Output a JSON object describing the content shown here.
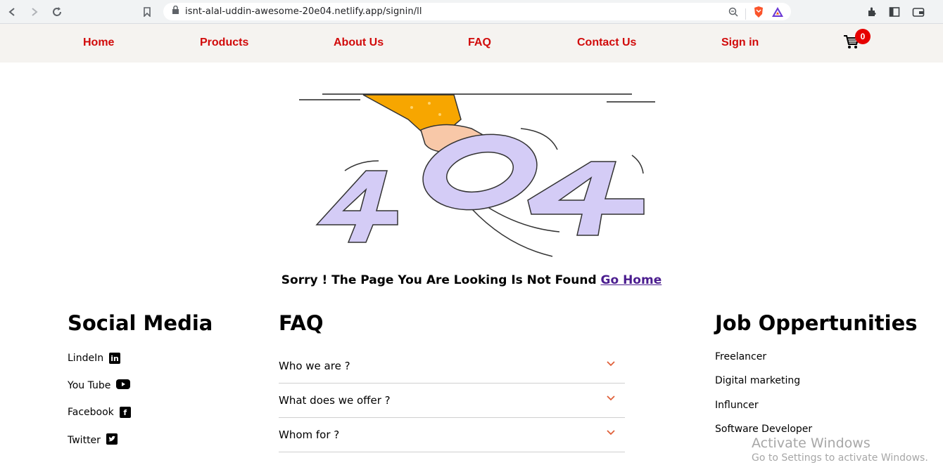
{
  "browser": {
    "url": "isnt-alal-uddin-awesome-20e04.netlify.app/signin/ll"
  },
  "nav": {
    "links": [
      "Home",
      "Products",
      "About Us",
      "FAQ",
      "Contact Us",
      "Sign in"
    ],
    "cart_count": "0",
    "link_color": "#d10a0a"
  },
  "error": {
    "image_text": "404",
    "message": "Sorry ! The Page You Are Looking Is Not Found",
    "go_home": "Go Home"
  },
  "footer": {
    "social": {
      "title": "Social Media",
      "items": [
        {
          "label": "LindeIn",
          "icon": "linkedin-icon"
        },
        {
          "label": "You Tube",
          "icon": "youtube-icon"
        },
        {
          "label": "Facebook",
          "icon": "facebook-icon"
        },
        {
          "label": "Twitter",
          "icon": "twitter-icon"
        }
      ]
    },
    "faq": {
      "title": "FAQ",
      "items": [
        "Who we are ?",
        "What does we offer ?",
        "Whom for ?"
      ]
    },
    "jobs": {
      "title": "Job Oppertunities",
      "items": [
        "Freelancer",
        "Digital marketing",
        "Influncer",
        "Software Developer"
      ]
    }
  },
  "watermark": {
    "line1": "Activate Windows",
    "line2": "Go to Settings to activate Windows."
  }
}
